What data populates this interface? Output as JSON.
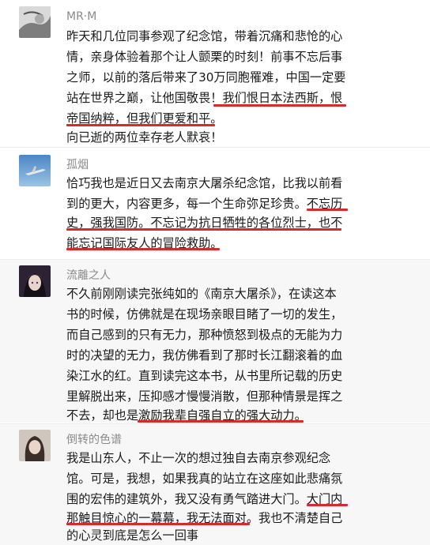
{
  "comments": [
    {
      "name": "MR·M",
      "avatar_icon": "sketch-portrait-icon",
      "lines": [
        "昨天和几位同事参观了纪念馆，带着沉痛和悲怆的心",
        "情，亲身体验着那个让人颤栗的时刻！前事不忘后事",
        "之师，以前的落后带来了30万同胞罹难，中国一定要",
        "站在世界之巅，让他国敬畏！我们恨日本法西斯，恨",
        "帝国纳粹，但我们更爱和平。",
        "向已逝的两位幸存老人默哀！"
      ]
    },
    {
      "name": "孤烟",
      "avatar_icon": "sky-jet-icon",
      "lines": [
        "恰巧我也是近日又去南京大屠杀纪念馆，比我以前看",
        "到的更大，内容更多，每一个生命弥足珍贵。不忘历",
        "史，强我国防。不忘记为抗日牺牲的各位烈士，也不",
        "能忘记国际友人的冒险救助。"
      ]
    },
    {
      "name": "流離之人",
      "avatar_icon": "anime-character-icon",
      "lines": [
        "不久前刚刚读完张纯如的《南京大屠杀》，在读这本",
        "书的时候，仿佛就是在现场亲眼目睹了一切的发生，",
        "而自己感到的只有无力，那种愤怒到极点的无能为力",
        "时的决望的无力，我仿佛看到了那时长江翻滚着的血",
        "染江水的红。直到读完这本书，从书里所记载的历史",
        "里解脱出来，压抑感才慢慢消散，但那种情景是挥之",
        "不去，却也是激励我辈自强自立的强大动力。"
      ]
    },
    {
      "name": "倒转的色谱",
      "avatar_icon": "portrait-girl-icon",
      "lines": [
        "我是山东人，不止一次的想过独自去南京参观纪念",
        "馆。可是，我想，如果我真的站立在这座如此悲痛氛",
        "围的宏伟的建筑外，我又没有勇气踏进大门。大门内",
        "那触目惊心的一幕幕，我无法面对。我也不清楚自己",
        "的心灵到底是怎么一回事"
      ]
    }
  ],
  "colors": {
    "underline": "#d42b2b",
    "name": "#8a8a8a",
    "text": "#1a1a1a"
  }
}
